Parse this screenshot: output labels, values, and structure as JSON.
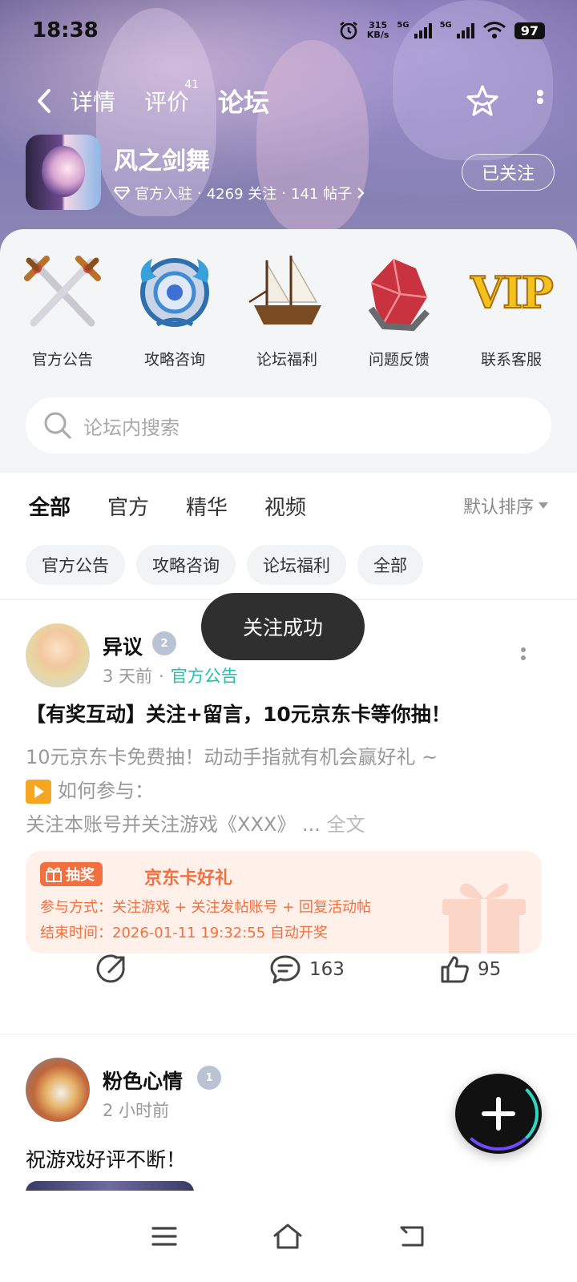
{
  "status_bar": {
    "time": "18:38",
    "net_speed_value": "315",
    "net_speed_unit": "KB/s",
    "signal_label_1": "5G",
    "signal_label_2": "5G",
    "battery": "97"
  },
  "nav": {
    "tabs": [
      {
        "label": "详情"
      },
      {
        "label": "评价",
        "badge": "41"
      },
      {
        "label": "论坛"
      }
    ],
    "active_tab": "论坛"
  },
  "game": {
    "name": "风之剑舞",
    "official_label": "官方入驻",
    "follow_count": "4269 关注",
    "post_count": "141 帖子",
    "sep": "·",
    "follow_button": "已关注"
  },
  "quick_entries": [
    {
      "label": "官方公告",
      "icon": "crossed-swords-icon"
    },
    {
      "label": "攻略咨询",
      "icon": "dragon-emblem-icon"
    },
    {
      "label": "论坛福利",
      "icon": "sailing-ship-icon"
    },
    {
      "label": "问题反馈",
      "icon": "red-crystal-icon"
    },
    {
      "label": "联系客服",
      "icon": "vip-gold-icon",
      "art_text": "VIP"
    }
  ],
  "search": {
    "placeholder": "论坛内搜索"
  },
  "feed_tabs": [
    "全部",
    "官方",
    "精华",
    "视频"
  ],
  "sort_label": "默认排序",
  "filter_chips": [
    "官方公告",
    "攻略咨询",
    "论坛福利",
    "全部"
  ],
  "toast": "关注成功",
  "posts": [
    {
      "author": "异议",
      "level": "2",
      "time": "3 天前",
      "sep": "·",
      "category": "官方公告",
      "title": "【有奖互动】关注+留言，10元京东卡等你抽！",
      "body_line1": "10元京东卡免费抽！动动手指就有机会赢好礼 ~",
      "body_line2": "如何参与：",
      "body_line3": "关注本账号并关注游戏《XXX》",
      "ellipsis": "...",
      "read_more": "全文",
      "lottery": {
        "tag": "抽奖",
        "title": "京东卡好礼",
        "method": "参与方式：关注游戏 + 关注发帖账号 + 回复活动帖",
        "end_time": "结束时间：2026-01-11 19:32:55 自动开奖"
      },
      "comments": "163",
      "likes": "95"
    },
    {
      "author": "粉色心情",
      "level": "1",
      "time": "2 小时前",
      "title": "祝游戏好评不断！"
    }
  ],
  "colors": {
    "accent": "#2bd9c6",
    "lottery": "#f2703f",
    "category_text": "#1ec0ae"
  }
}
